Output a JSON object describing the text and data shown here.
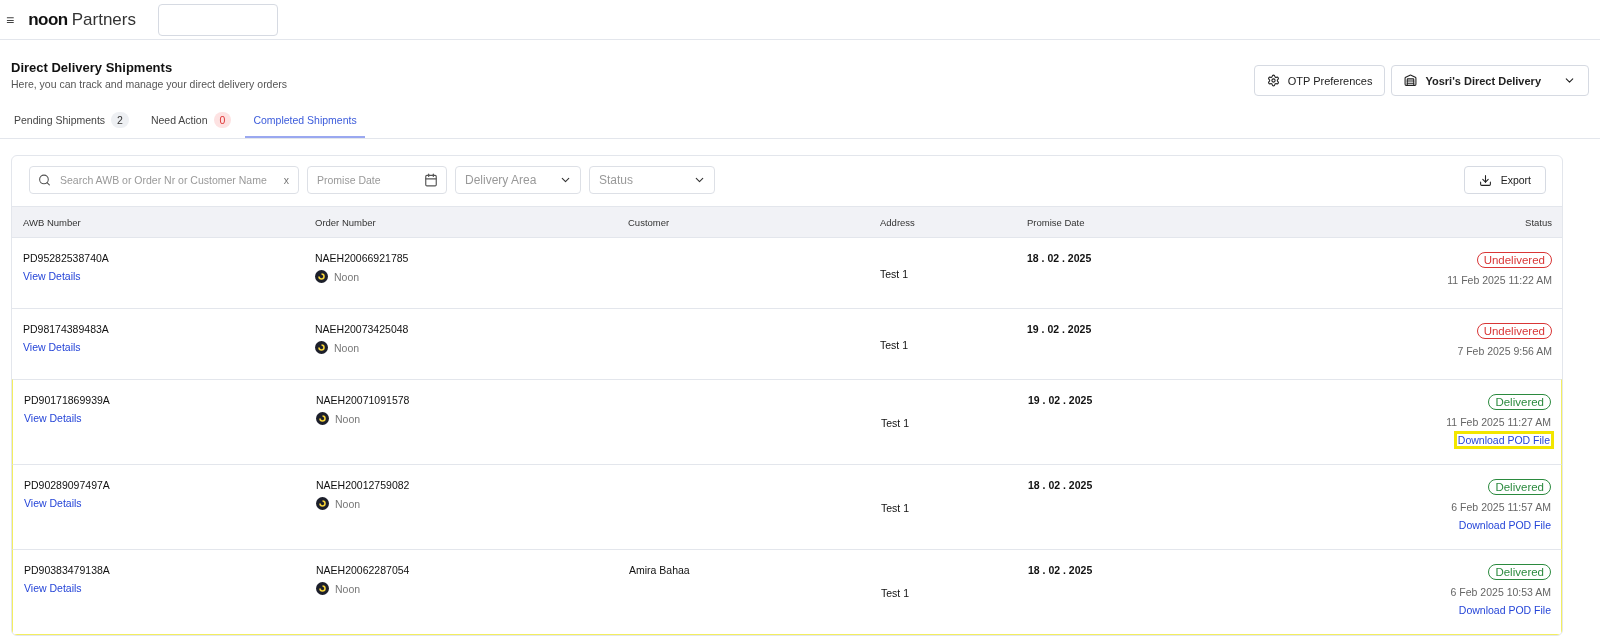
{
  "header": {
    "menu_icon": "≡",
    "brand_bold": "noon",
    "brand_light": "Partners"
  },
  "page": {
    "title": "Direct Delivery Shipments",
    "subtitle": "Here, you can track and manage your direct delivery orders"
  },
  "actions": [
    {
      "kind": "otp",
      "label": "OTP Preferences"
    },
    {
      "kind": "store",
      "label": "Yosri's Direct Delivery"
    }
  ],
  "tabs": [
    {
      "label": "Pending Shipments",
      "count": {
        "text": "2",
        "kind": "neutral"
      },
      "selected": false
    },
    {
      "label": "Need Action",
      "count": {
        "text": "0",
        "kind": "alert"
      },
      "selected": false
    },
    {
      "label": "Completed Shipments",
      "selected": true
    }
  ],
  "filters": {
    "search": {
      "placeholder": "Search AWB or Order Nr or Customer Name",
      "clear": "x"
    },
    "date": {
      "placeholder": "Promise Date"
    },
    "selects": [
      {
        "placeholder": "Delivery Area"
      },
      {
        "placeholder": "Status"
      }
    ],
    "export": "Export"
  },
  "table": {
    "columns": [
      "AWB Number",
      "Order Number",
      "Customer",
      "Address",
      "Promise Date",
      "Status"
    ],
    "rows": [
      {
        "awb": "PD95282538740A",
        "link": "View Details",
        "order": "NAEH20066921785",
        "seller": "Noon",
        "address": "Test 1",
        "promise_date": "18 . 02 . 2025",
        "status": {
          "label": "Undelivered",
          "kind": "failed"
        },
        "timestamp": "11 Feb 2025 11:22 AM",
        "highlighted": false
      },
      {
        "awb": "PD98174389483A",
        "link": "View Details",
        "order": "NAEH20073425048",
        "seller": "Noon",
        "address": "Test 1",
        "promise_date": "19 . 02 . 2025",
        "status": {
          "label": "Undelivered",
          "kind": "failed"
        },
        "timestamp": "7 Feb 2025 9:56 AM",
        "highlighted": false
      },
      {
        "awb": "PD90171869939A",
        "link": "View Details",
        "order": "NAEH20071091578",
        "seller": "Noon",
        "address": "Test 1",
        "promise_date": "19 . 02 . 2025",
        "status": {
          "label": "Delivered",
          "kind": "success"
        },
        "timestamp": "11 Feb 2025 11:27 AM",
        "download": "Download POD File",
        "download_highlighted": true,
        "highlighted": true
      },
      {
        "awb": "PD90289097497A",
        "link": "View Details",
        "order": "NAEH20012759082",
        "seller": "Noon",
        "address": "Test 1",
        "promise_date": "18 . 02 . 2025",
        "status": {
          "label": "Delivered",
          "kind": "success"
        },
        "timestamp": "6 Feb 2025 11:57 AM",
        "download": "Download POD File",
        "download_highlighted": false,
        "highlighted": true
      },
      {
        "awb": "PD90383479138A",
        "link": "View Details",
        "order": "NAEH20062287054",
        "seller": "Noon",
        "customer": "Amira Bahaa",
        "address": "Test 1",
        "promise_date": "18 . 02 . 2025",
        "status": {
          "label": "Delivered",
          "kind": "success"
        },
        "timestamp": "6 Feb 2025 10:53 AM",
        "download": "Download POD File",
        "download_highlighted": false,
        "highlighted": true
      }
    ]
  }
}
